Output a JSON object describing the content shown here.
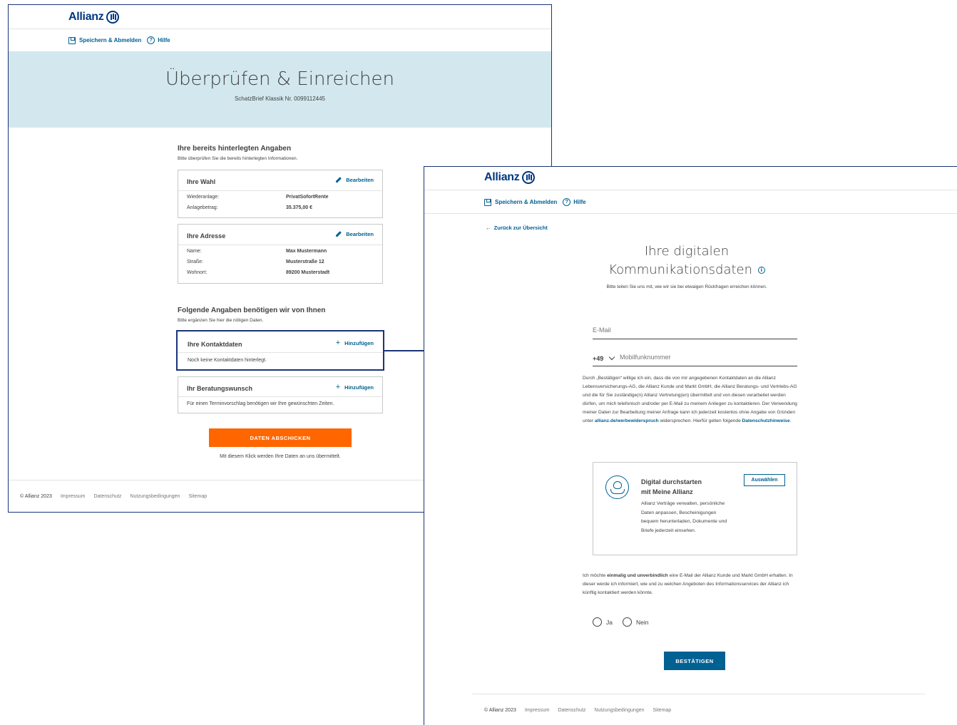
{
  "brand": {
    "name": "Allianz"
  },
  "screen1": {
    "utility": {
      "save_logout": "Speichern & Abmelden",
      "help": "Hilfe"
    },
    "hero": {
      "title": "Überprüfen & Einreichen",
      "subtitle": "SchatzBrief Klassik Nr. 0099112445"
    },
    "existing": {
      "title": "Ihre bereits hinterlegten Angaben",
      "subtitle": "Bitte überprüfen Sie die bereits hinterlegten Informationen."
    },
    "card_choice": {
      "title": "Ihre Wahl",
      "action": "Bearbeiten",
      "rows": [
        {
          "label": "Wiederanlage:",
          "value": "PrivatSofortRente"
        },
        {
          "label": "Anlagebetrag:",
          "value": "35.375,00 €"
        }
      ]
    },
    "card_address": {
      "title": "Ihre Adresse",
      "action": "Bearbeiten",
      "rows": [
        {
          "label": "Name:",
          "value": "Max Mustermann"
        },
        {
          "label": "Straße:",
          "value": "Musterstraße 12"
        },
        {
          "label": "Wohnort:",
          "value": "89200 Musterstadt"
        }
      ]
    },
    "needed": {
      "title": "Folgende Angaben benötigen wir von Ihnen",
      "subtitle": "Bitte ergänzen Sie hier die nötigen Daten."
    },
    "card_contact": {
      "title": "Ihre Kontaktdaten",
      "action": "Hinzufügen",
      "note": "Noch keine Kontaktdaten hinterlegt."
    },
    "card_consult": {
      "title": "Ihr Beratungswunsch",
      "action": "Hinzufügen",
      "note": "Für einen Terminvorschlag benötigen wir Ihre gewünschten Zeiten."
    },
    "submit": {
      "label": "DATEN ABSCHICKEN",
      "note": "Mit diesem Klick werden Ihre Daten an uns übermittelt."
    },
    "footer": [
      "© Allianz 2023",
      "Impressum",
      "Datenschutz",
      "Nutzungsbedingungen",
      "Sitemap"
    ]
  },
  "screen2": {
    "utility": {
      "save_logout": "Speichern & Abmelden",
      "help": "Hilfe"
    },
    "back": "Zurück zur Übersicht",
    "title_line1": "Ihre digitalen",
    "title_line2": "Kommunikationsdaten",
    "subtitle": "Bitte teilen Sie uns mit, wie wir sie bei etwaigen Rückfragen erreichen können.",
    "email_placeholder": "E-Mail",
    "phone_prefix": "+49",
    "phone_placeholder": "Mobilfunknummer",
    "legal_text_1": "Durch „Bestätigen“ willige ich ein, dass die von mir angegebenen Kontaktdaten an die Allianz Lebensversicherungs-AG, die Allianz Kunde und Markt GmbH, die Allianz Beratungs- und Vertriebs-AG und die für Sie zuständige(n) Allianz Vertretung(en) übermittelt und von diesen verarbeitet werden dürfen, um mich telefonisch und/oder per E-Mail zu meinem Anliegen zu kontaktieren. Der Verwendung meiner Daten zur Bearbeitung meiner Anfrage kann ich jederzeit kostenlos ohne Angabe von Gründen unter ",
    "legal_link_1": "allianz.de/werbewiderspruch",
    "legal_text_2": " widersprechen. Hierfür gelten folgende ",
    "legal_link_2": "Datenschutzhinweise",
    "legal_text_3": ".",
    "promo": {
      "title_line1": "Digital durchstarten",
      "title_line2": "mit Meine Allianz",
      "body": "Allianz Verträge verwalten, persönliche Daten anpassen, Bescheinigungen bequem herunterladen, Dokumente und Briefe jederzeit einsehen.",
      "button": "Auswählen"
    },
    "optin_1": "Ich möchte ",
    "optin_bold": "einmalig und unverbindlich",
    "optin_2": " eine E-Mail der Allianz Kunde und Markt GmbH erhalten. In dieser werde ich informiert, wie und zu welchen Angeboten des Informationsservices der Allianz ich künftig kontaktiert werden könnte.",
    "radio_yes": "Ja",
    "radio_no": "Nein",
    "confirm": "BESTÄTIGEN",
    "footer": [
      "© Allianz 2023",
      "Impressum",
      "Datenschutz",
      "Nutzungsbedingungen",
      "Sitemap"
    ]
  }
}
